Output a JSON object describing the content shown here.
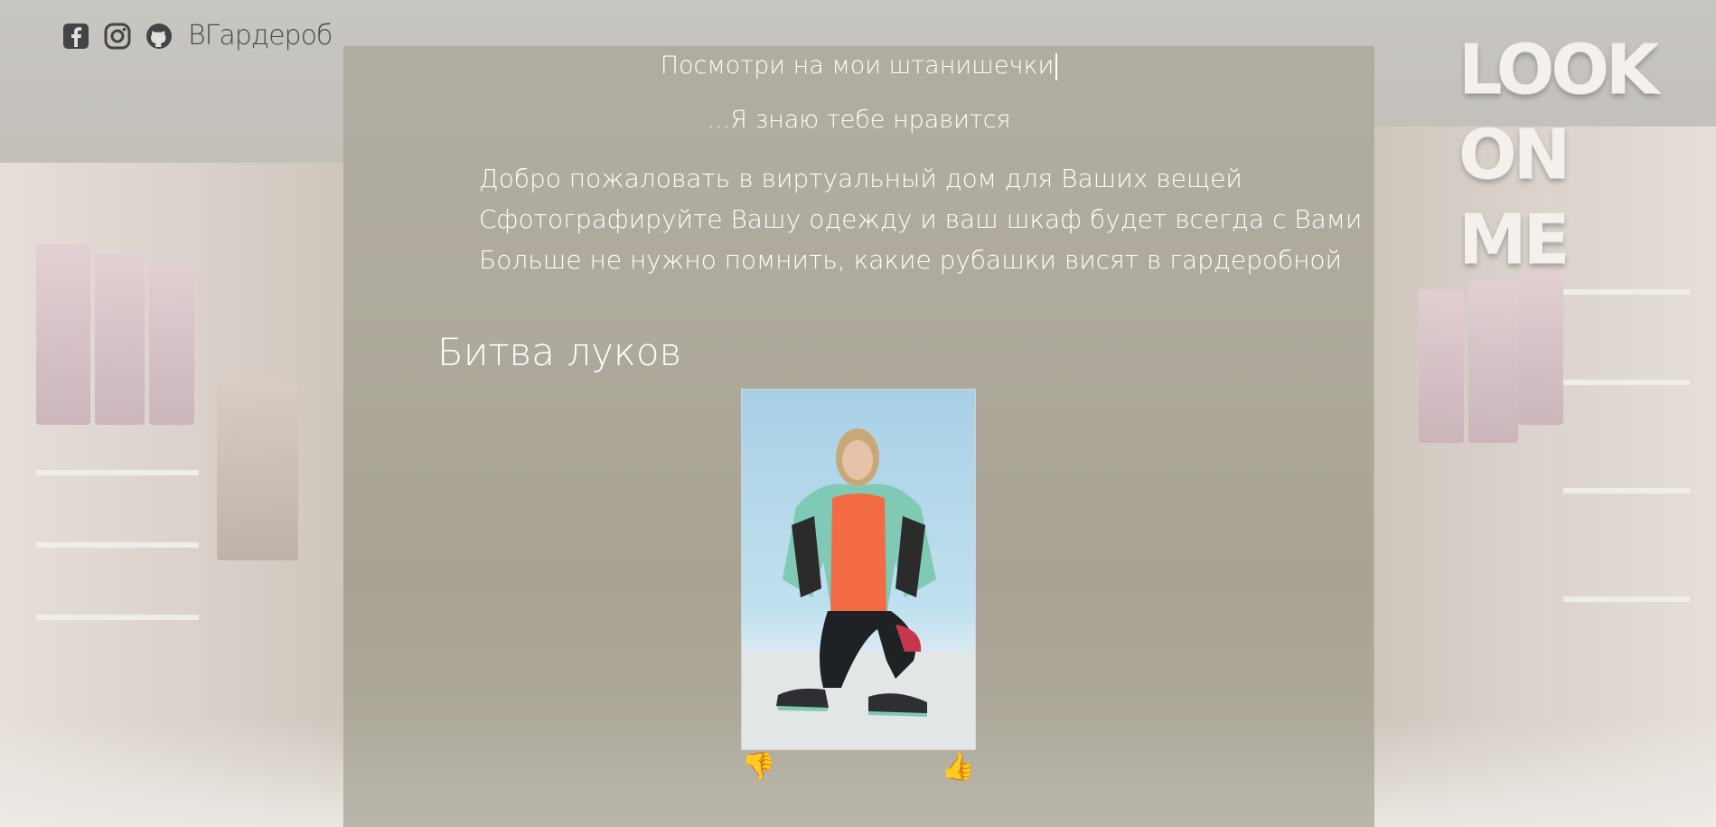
{
  "header": {
    "brand": "ВГардероб",
    "icons": [
      "facebook-icon",
      "instagram-icon",
      "github-icon"
    ]
  },
  "hero": {
    "tagline_main": "Посмотри на мои штанишечки",
    "tagline_sub": "...Я знаю тебе нравится",
    "intro_lines": [
      "Добро пожаловать в виртуальный дом для Ваших вещей",
      "Сфотографируйте Вашу одежду и ваш шкаф будет всегда с Вами",
      "Больше не нужно помнить, какие рубашки висят в гардеробной"
    ]
  },
  "battle": {
    "title": "Битва луков",
    "dislike_label": "👎",
    "like_label": "👍"
  },
  "logo": {
    "lines": [
      "LOOK",
      "ON",
      "ME"
    ]
  },
  "colors": {
    "overlay": "#a8a494",
    "text_light": "#ffffff",
    "brand_text": "#4a4a4a",
    "logo": "#f4f1ec"
  }
}
